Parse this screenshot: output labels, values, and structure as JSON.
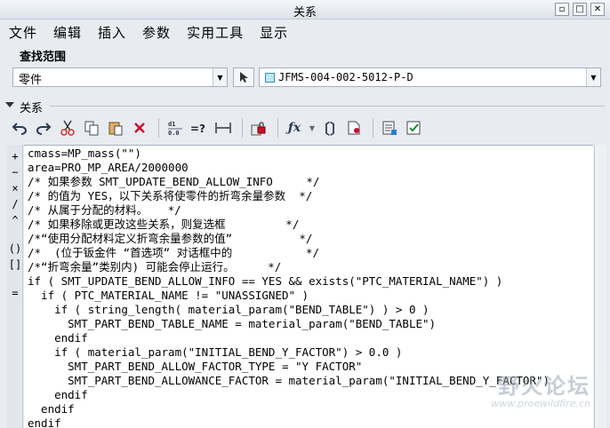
{
  "window": {
    "title": "关系",
    "minimize": "▫",
    "restore": "□",
    "close": "✕"
  },
  "menu": [
    "文件",
    "编辑",
    "插入",
    "参数",
    "实用工具",
    "显示"
  ],
  "scope": {
    "heading": "查找范围",
    "type_value": "零件",
    "model_value": "JFMS-004-002-5012-P-D"
  },
  "relations_section": {
    "label": "关系"
  },
  "toolbar_icons": [
    "undo-icon",
    "redo-icon",
    "cut-icon",
    "copy-icon",
    "paste-icon",
    "delete-icon",
    "evaluate-icon",
    "verify-icon",
    "dimension-icon",
    "lock-icon",
    "function-icon",
    "dropdown-icon",
    "brackets-icon",
    "sort-icon",
    "insert-icon",
    "check-icon"
  ],
  "side_buttons": [
    "+",
    "−",
    "×",
    "/",
    "^",
    "()",
    "[]",
    "="
  ],
  "code_lines": [
    "cmass=MP_mass(\"\")",
    "area=PRO_MP_AREA/2000000",
    "/* 如果参数 SMT_UPDATE_BEND_ALLOW_INFO     */",
    "/* 的值为 YES，以下关系将使零件的折弯余量参数  */",
    "/* 从属于分配的材料。   */",
    "/* 如果移除或更改这些关系，则复选框         */",
    "/*“使用分配材料定义折弯余量参数的值”          */",
    "/*  (位于钣金件 “首选项” 对话框中的           */",
    "/*“折弯余量”类别内) 可能会停止运行。     */",
    "if ( SMT_UPDATE_BEND_ALLOW_INFO == YES && exists(\"PTC_MATERIAL_NAME\") )",
    "  if ( PTC_MATERIAL_NAME != \"UNASSIGNED\" )",
    "    if ( string_length( material_param(\"BEND_TABLE\") ) > 0 )",
    "      SMT_PART_BEND_TABLE_NAME = material_param(\"BEND_TABLE\")",
    "    endif",
    "    if ( material_param(\"INITIAL_BEND_Y_FACTOR\") > 0.0 )",
    "      SMT_PART_BEND_ALLOW_FACTOR_TYPE = \"Y FACTOR\"",
    "      SMT_PART_BEND_ALLOWANCE_FACTOR = material_param(\"INITIAL_BEND_Y_FACTOR\")",
    "    endif",
    "  endif",
    "endif"
  ],
  "watermark": {
    "logo": "野火论坛",
    "url": "www.proewildfire.cn"
  }
}
